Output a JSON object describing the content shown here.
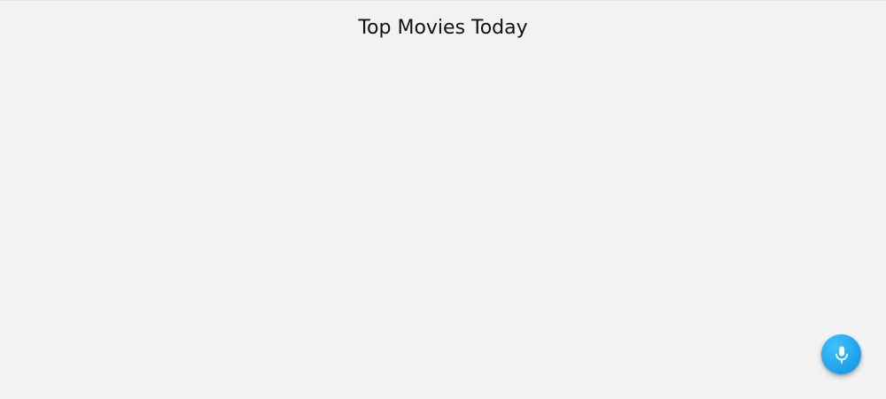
{
  "page": {
    "title": "Top Movies Today"
  },
  "voice_button": {
    "icon": "microphone-icon",
    "color": "#1fa4ee"
  },
  "theme": {
    "background": "#f2f2f2",
    "title_color": "#111111"
  }
}
